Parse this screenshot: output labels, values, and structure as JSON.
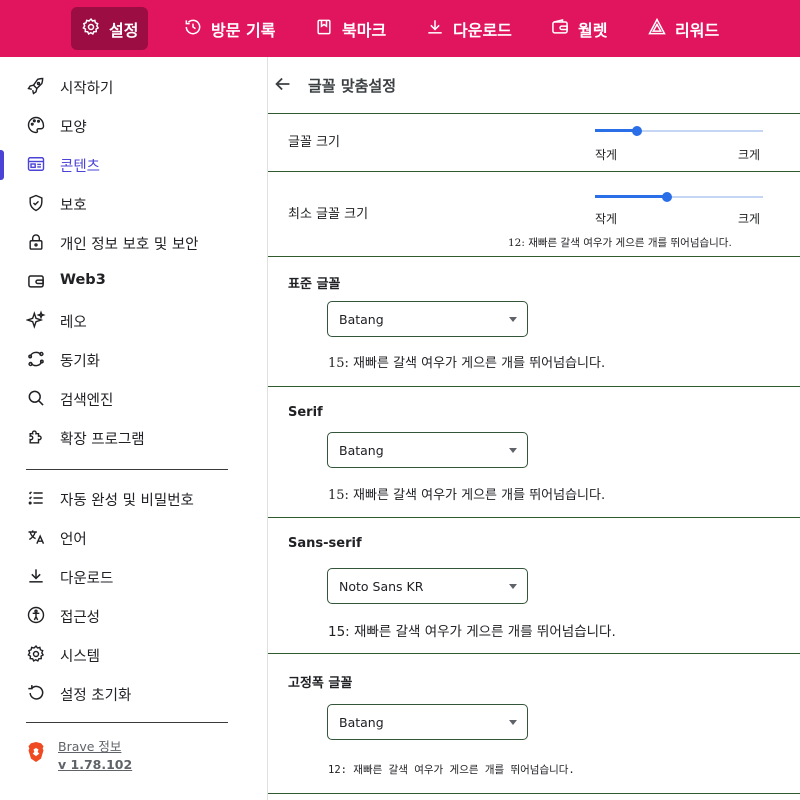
{
  "colors": {
    "topbar": "#e0155e",
    "topbar_active": "#9c0d43",
    "accent": "#4a43d6",
    "slider": "#2a6ee8"
  },
  "topbar": {
    "tabs": [
      {
        "label": "설정",
        "icon": "gear-icon",
        "active": true
      },
      {
        "label": "방문 기록",
        "icon": "history-icon",
        "active": false
      },
      {
        "label": "북마크",
        "icon": "bookmark-icon",
        "active": false
      },
      {
        "label": "다운로드",
        "icon": "download-icon",
        "active": false
      },
      {
        "label": "월렛",
        "icon": "wallet-icon",
        "active": false
      },
      {
        "label": "리워드",
        "icon": "rewards-icon",
        "active": false
      }
    ]
  },
  "sidebar": {
    "items": [
      {
        "label": "시작하기",
        "icon": "rocket-icon"
      },
      {
        "label": "모양",
        "icon": "palette-icon"
      },
      {
        "label": "콘텐츠",
        "icon": "content-icon",
        "active": true
      },
      {
        "label": "보호",
        "icon": "shield-icon"
      },
      {
        "label": "개인 정보 보호 및 보안",
        "icon": "lock-icon"
      },
      {
        "label": "Web3",
        "icon": "wallet-icon"
      },
      {
        "label": "레오",
        "icon": "sparkle-icon"
      },
      {
        "label": "동기화",
        "icon": "sync-icon"
      },
      {
        "label": "검색엔진",
        "icon": "search-icon"
      },
      {
        "label": "확장 프로그램",
        "icon": "puzzle-icon"
      }
    ],
    "items2": [
      {
        "label": "자동 완성 및 비밀번호",
        "icon": "list-icon"
      },
      {
        "label": "언어",
        "icon": "translate-icon"
      },
      {
        "label": "다운로드",
        "icon": "download-icon"
      },
      {
        "label": "접근성",
        "icon": "accessibility-icon"
      },
      {
        "label": "시스템",
        "icon": "gear-icon"
      },
      {
        "label": "설정 초기화",
        "icon": "reset-icon"
      }
    ],
    "about_label": "Brave 정보",
    "version": "v 1.78.102"
  },
  "content": {
    "title": "글꼴 맞춤설정",
    "font_size": {
      "label": "글꼴 크기",
      "min_label": "작게",
      "max_label": "크게",
      "value": 0.25
    },
    "min_font_size": {
      "label": "최소 글꼴 크기",
      "min_label": "작게",
      "max_label": "크게",
      "value": 0.43,
      "preview": "12: 재빠른 갈색 여우가 게으른 개를 뛰어넘습니다."
    },
    "standard": {
      "label": "표준 글꼴",
      "value": "Batang",
      "preview": "15: 재빠른 갈색 여우가 게으른 개를 뛰어넘습니다."
    },
    "serif": {
      "label": "Serif",
      "value": "Batang",
      "preview": "15: 재빠른 갈색 여우가 게으른 개를 뛰어넘습니다."
    },
    "sans_serif": {
      "label": "Sans-serif",
      "value": "Noto Sans KR",
      "preview": "15: 재빠른 갈색 여우가 게으른 개를 뛰어넘습니다."
    },
    "fixed": {
      "label": "고정폭 글꼴",
      "value": "Batang",
      "preview": "12: 재빠른 갈색 여우가 게으른 개를 뛰어넘습니다."
    }
  }
}
